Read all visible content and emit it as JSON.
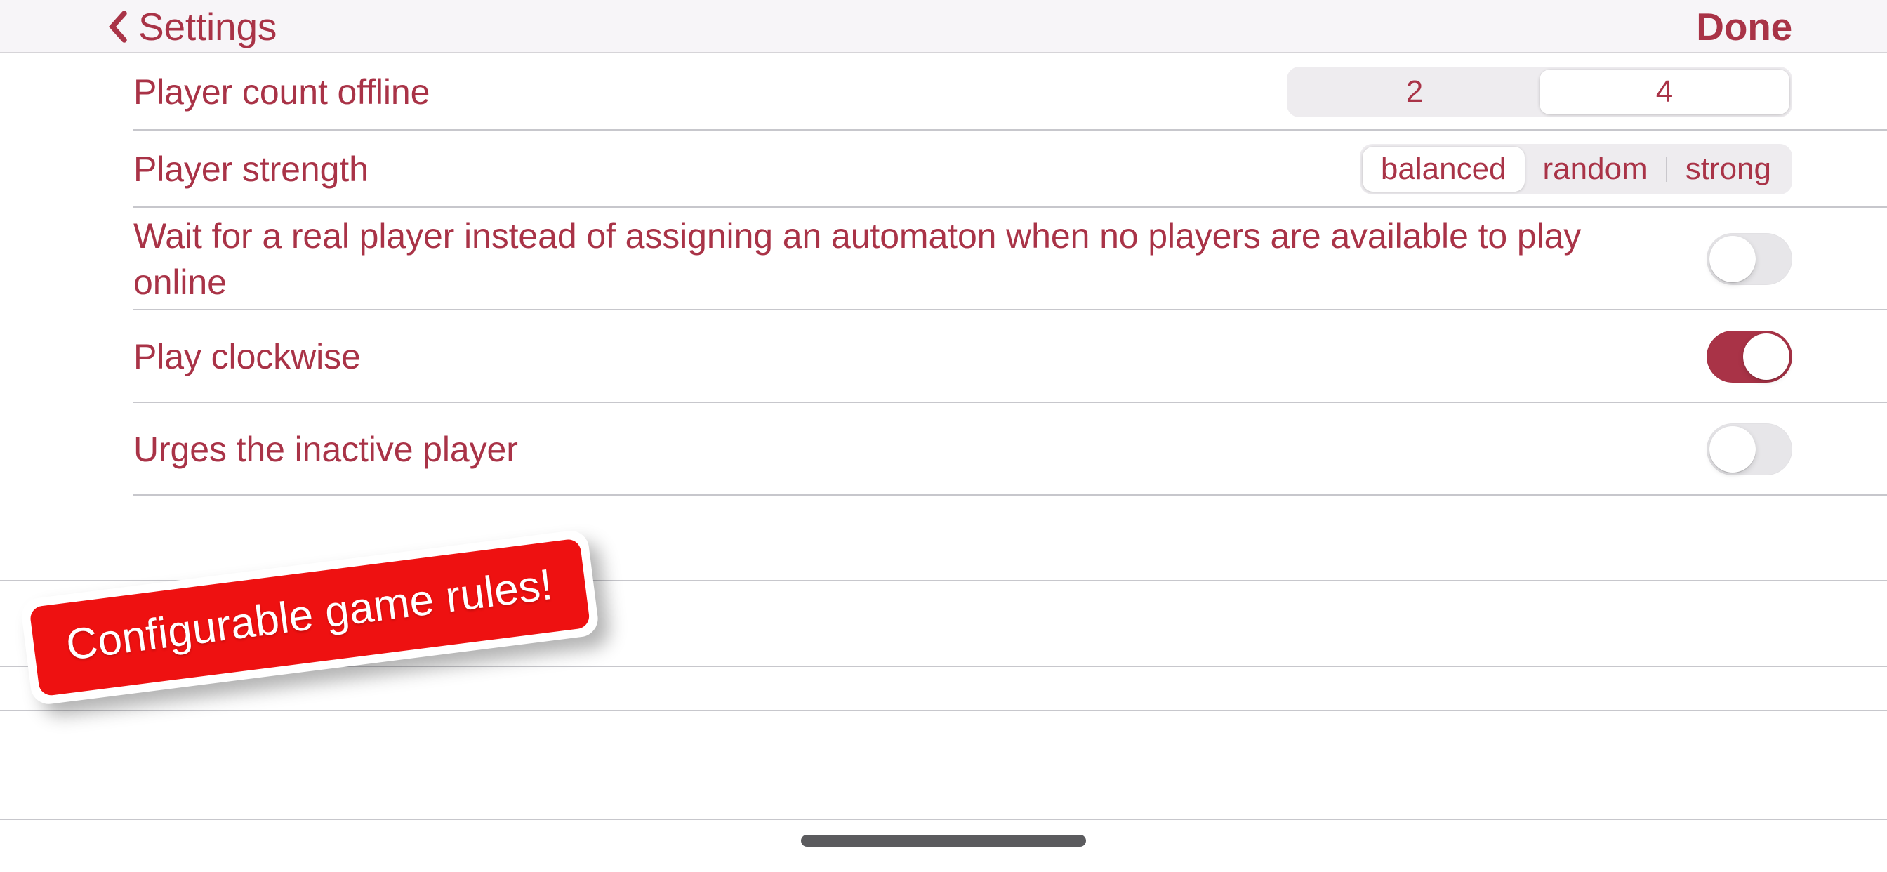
{
  "nav": {
    "back_label": "Settings",
    "back_icon": "chevron-left-icon",
    "done_label": "Done",
    "accent_color": "#a93347"
  },
  "settings": {
    "rows": [
      {
        "id": "player-count-offline",
        "label": "Player count offline",
        "control": "segmented",
        "options": [
          "2",
          "4"
        ],
        "selected": "4"
      },
      {
        "id": "player-strength",
        "label": "Player strength",
        "control": "segmented",
        "options": [
          "balanced",
          "random",
          "strong"
        ],
        "selected": "balanced"
      },
      {
        "id": "wait-for-real-player",
        "label": "Wait for a real player instead of assigning an automaton when no players are available to play online",
        "control": "switch",
        "value": "off"
      },
      {
        "id": "play-clockwise",
        "label": "Play clockwise",
        "control": "switch",
        "value": "on"
      },
      {
        "id": "urges-inactive-player",
        "label": "Urges the inactive player",
        "control": "switch",
        "value": "off"
      }
    ]
  },
  "sticker": {
    "text": "Configurable game rules!",
    "background_color": "#ee1111",
    "text_color": "#ffffff"
  },
  "home_indicator": {
    "color": "#5b5b5e"
  },
  "colors": {
    "accent": "#a93347",
    "nav_background": "#f7f5f8",
    "segment_track": "#eeecef",
    "switch_off_track": "#e7e6e9",
    "switch_on_track": "#a93347",
    "separator": "#c7c7cc"
  }
}
